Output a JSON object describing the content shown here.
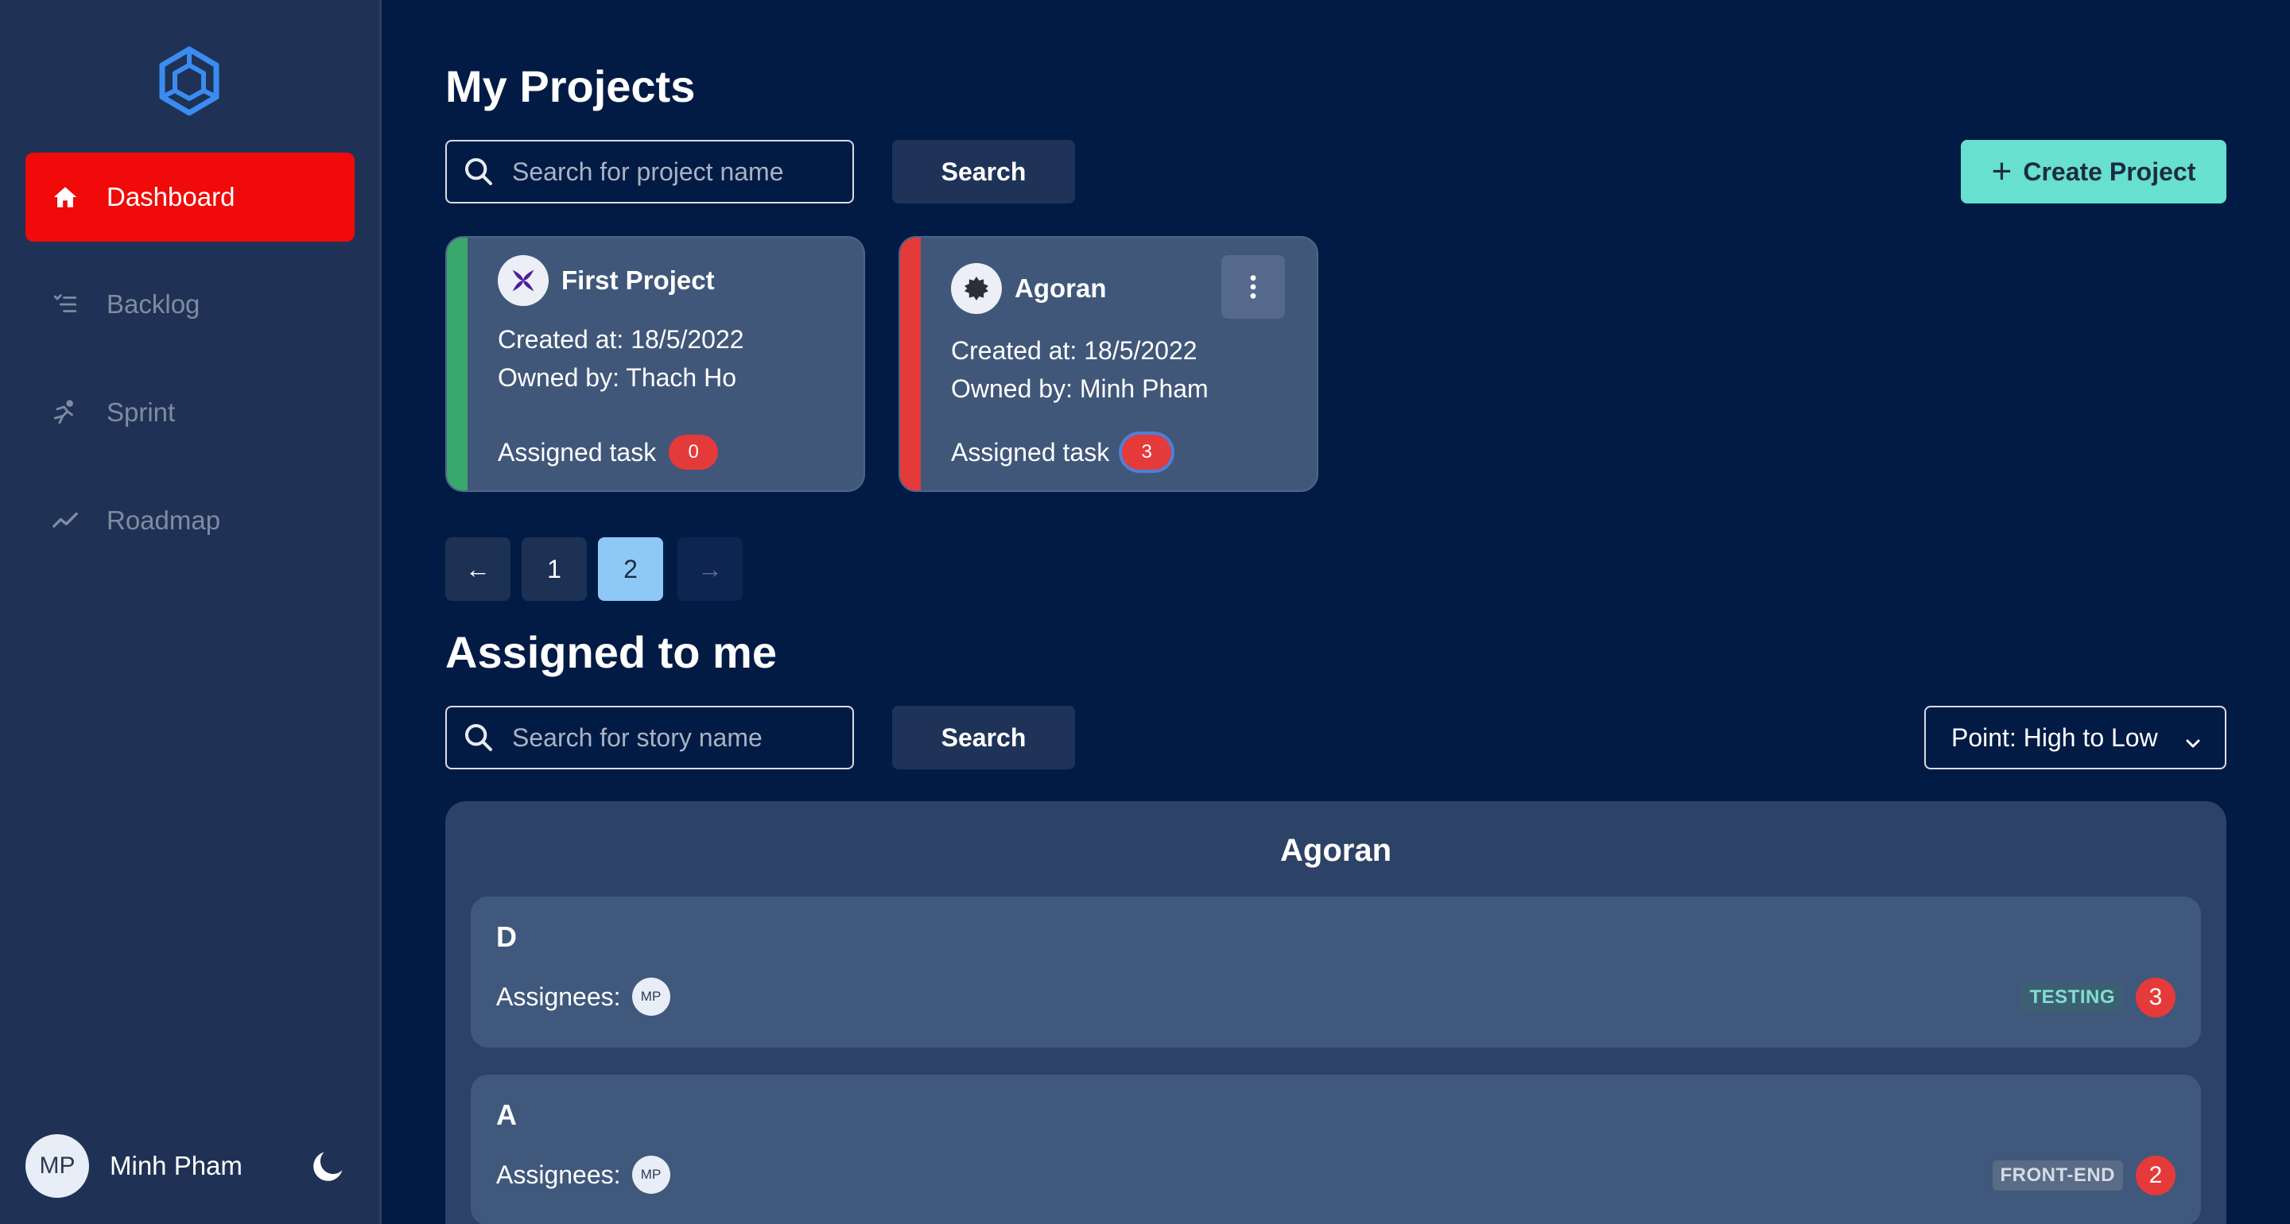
{
  "sidebar": {
    "items": [
      {
        "label": "Dashboard",
        "icon": "home-icon",
        "active": true
      },
      {
        "label": "Backlog",
        "icon": "backlog-list-icon",
        "active": false
      },
      {
        "label": "Sprint",
        "icon": "sprint-runner-icon",
        "active": false
      },
      {
        "label": "Roadmap",
        "icon": "roadmap-trend-icon",
        "active": false
      }
    ],
    "user": {
      "initials": "MP",
      "name": "Minh Pham"
    }
  },
  "projects": {
    "title": "My Projects",
    "search_placeholder": "Search for project name",
    "search_label": "Search",
    "create_label": "Create Project",
    "cards": [
      {
        "name": "First Project",
        "created": "Created at: 18/5/2022",
        "owner": "Owned by: Thach Ho",
        "assigned_label": "Assigned task",
        "assigned_count": "0",
        "stripe": "#3aa76d"
      },
      {
        "name": "Agoran",
        "created": "Created at: 18/5/2022",
        "owner": "Owned by: Minh Pham",
        "assigned_label": "Assigned task",
        "assigned_count": "3",
        "stripe": "#e53a3a"
      }
    ],
    "pagination": {
      "prev": "←",
      "pages": [
        "1",
        "2"
      ],
      "current": "2",
      "next": "→"
    }
  },
  "assigned": {
    "title": "Assigned to me",
    "search_placeholder": "Search for story name",
    "search_label": "Search",
    "sort_value": "Point: High to Low",
    "group": {
      "title": "Agoran",
      "stories": [
        {
          "name": "D",
          "assignees_label": "Assignees:",
          "assignee": "MP",
          "tag": "TESTING",
          "points": "3",
          "tag_bg": "#3d5f72",
          "tag_fg": "#7fe0cf"
        },
        {
          "name": "A",
          "assignees_label": "Assignees:",
          "assignee": "MP",
          "tag": "FRONT-END",
          "points": "2",
          "tag_bg": "#5a6b86",
          "tag_fg": "#d5dbe6"
        }
      ]
    }
  },
  "colors": {
    "accent_active": "#f00a0a",
    "create": "#67e0cf",
    "badge": "#e53a3a",
    "logo": "#3b8cf0"
  }
}
